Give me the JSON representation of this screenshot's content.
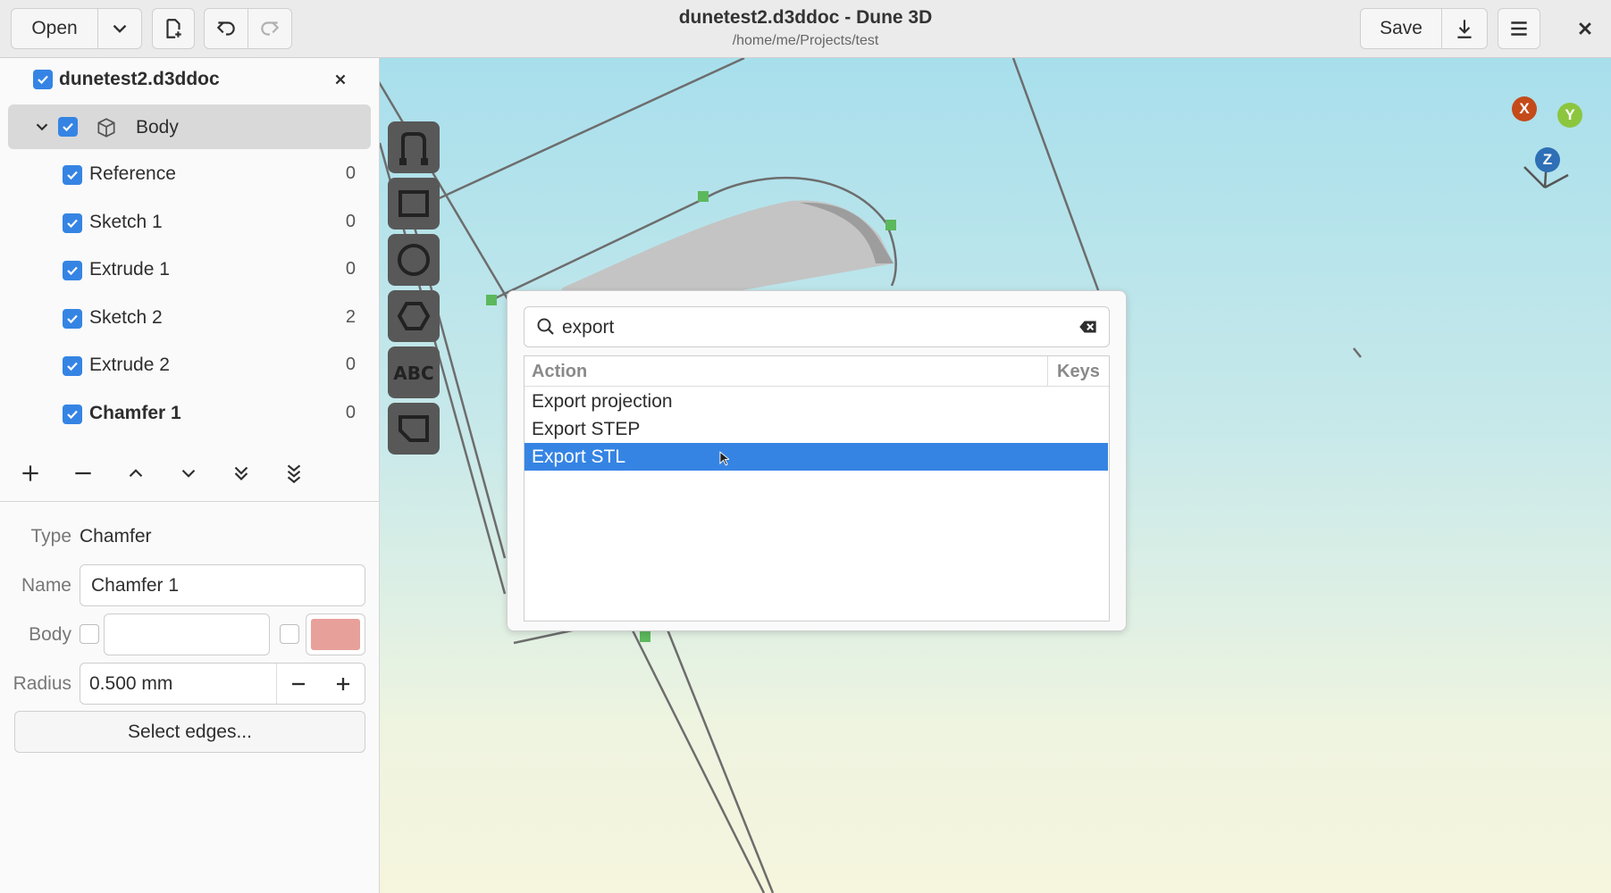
{
  "header": {
    "open_label": "Open",
    "save_label": "Save",
    "title": "dunetest2.d3ddoc - Dune 3D",
    "subtitle": "/home/me/Projects/test"
  },
  "sidebar": {
    "document_name": "dunetest2.d3ddoc",
    "body_label": "Body",
    "items": [
      {
        "label": "Reference",
        "count": "0"
      },
      {
        "label": "Sketch 1",
        "count": "0"
      },
      {
        "label": "Extrude 1",
        "count": "0"
      },
      {
        "label": "Sketch 2",
        "count": "2"
      },
      {
        "label": "Extrude 2",
        "count": "0"
      },
      {
        "label": "Chamfer 1",
        "count": "0"
      }
    ]
  },
  "properties": {
    "type_label": "Type",
    "type_value": "Chamfer",
    "name_label": "Name",
    "name_value": "Chamfer 1",
    "body_label": "Body",
    "radius_label": "Radius",
    "radius_value": "0.500 mm",
    "select_edges_label": "Select edges...",
    "swatch_color": "#e8a09a"
  },
  "viewport": {
    "axes": {
      "x": "X",
      "y": "Y",
      "z": "Z"
    },
    "colors": {
      "x": "#c44a1a",
      "y": "#8cc63f",
      "z": "#2f6fb5"
    }
  },
  "dialog": {
    "search_value": "export",
    "col_action": "Action",
    "col_keys": "Keys",
    "actions": [
      "Export projection",
      "Export STEP",
      "Export STL"
    ],
    "selected_index": 2,
    "selected_color": "#3584e4"
  }
}
